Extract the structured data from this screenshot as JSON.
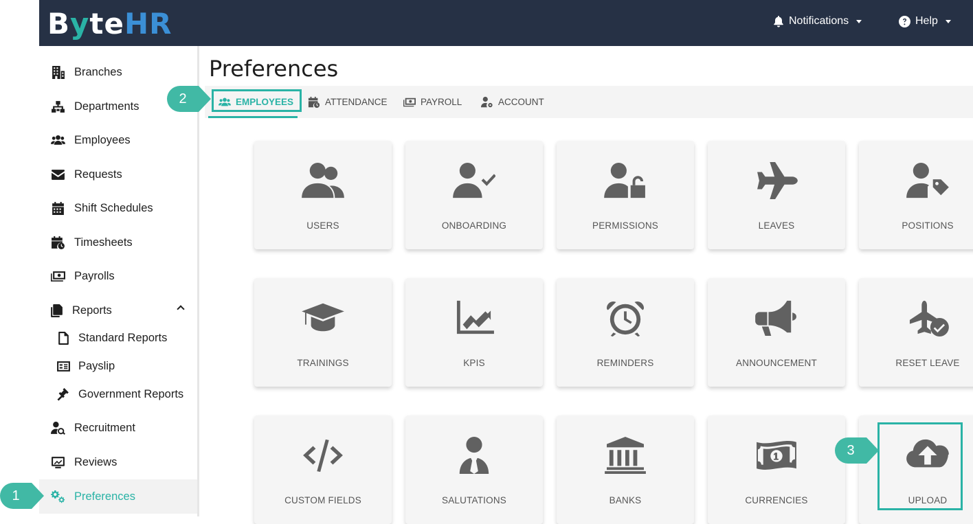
{
  "app": {
    "logo_by": "B",
    "logo_y": "y",
    "logo_te": "te",
    "logo_hr": "HR"
  },
  "topbar": {
    "notifications_label": "Notifications",
    "help_label": "Help"
  },
  "sidebar": {
    "items": [
      {
        "label": "Branches",
        "icon": "building-icon"
      },
      {
        "label": "Departments",
        "icon": "sitemap-icon"
      },
      {
        "label": "Employees",
        "icon": "users-icon"
      },
      {
        "label": "Requests",
        "icon": "envelope-icon"
      },
      {
        "label": "Shift Schedules",
        "icon": "calendar-icon"
      },
      {
        "label": "Timesheets",
        "icon": "calendar-clock-icon"
      },
      {
        "label": "Payrolls",
        "icon": "money-icon"
      },
      {
        "label": "Reports",
        "icon": "copy-icon"
      },
      {
        "label": "Standard Reports",
        "icon": "file-icon"
      },
      {
        "label": "Payslip",
        "icon": "id-card-icon"
      },
      {
        "label": "Government Reports",
        "icon": "gavel-icon"
      },
      {
        "label": "Recruitment",
        "icon": "user-search-icon"
      },
      {
        "label": "Reviews",
        "icon": "chart-board-icon"
      },
      {
        "label": "Preferences",
        "icon": "gears-icon"
      }
    ]
  },
  "page": {
    "title": "Preferences"
  },
  "tabs": [
    {
      "label": "EMPLOYEES"
    },
    {
      "label": "ATTENDANCE"
    },
    {
      "label": "PAYROLL"
    },
    {
      "label": "ACCOUNT"
    }
  ],
  "cards": [
    {
      "label": "USERS",
      "icon": "users-icon"
    },
    {
      "label": "ONBOARDING",
      "icon": "user-check-icon"
    },
    {
      "label": "PERMISSIONS",
      "icon": "user-lock-icon"
    },
    {
      "label": "LEAVES",
      "icon": "plane-icon"
    },
    {
      "label": "POSITIONS",
      "icon": "user-tag-icon"
    },
    {
      "label": "TRAININGS",
      "icon": "graduation-cap-icon"
    },
    {
      "label": "KPIS",
      "icon": "chart-line-icon"
    },
    {
      "label": "REMINDERS",
      "icon": "alarm-clock-icon"
    },
    {
      "label": "ANNOUNCEMENT",
      "icon": "bullhorn-icon"
    },
    {
      "label": "RESET LEAVE",
      "icon": "plane-check-icon"
    },
    {
      "label": "CUSTOM FIELDS",
      "icon": "code-icon"
    },
    {
      "label": "SALUTATIONS",
      "icon": "user-tie-icon"
    },
    {
      "label": "BANKS",
      "icon": "bank-icon"
    },
    {
      "label": "CURRENCIES",
      "icon": "money-bill-icon"
    },
    {
      "label": "UPLOAD",
      "icon": "cloud-upload-icon"
    }
  ],
  "callouts": [
    "1",
    "2",
    "3"
  ],
  "colors": {
    "accent": "#2ab3a6",
    "topbar": "#263145",
    "callout": "#41b9a5"
  }
}
